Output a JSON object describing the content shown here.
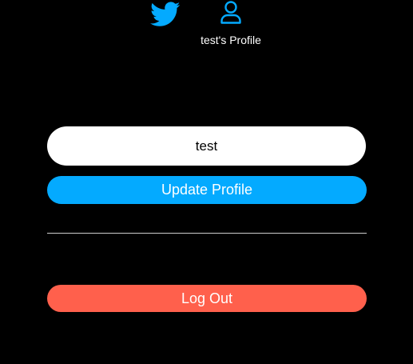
{
  "colors": {
    "background": "#000000",
    "accent_blue": "#04aaff",
    "logout_red": "#ff604c",
    "input_background": "#ffffff"
  },
  "nav": {
    "home_icon": "twitter-bird-icon",
    "profile_icon": "user-icon",
    "profile_label": "test's Profile"
  },
  "profile_form": {
    "display_name_value": "test",
    "update_button_label": "Update Profile"
  },
  "logout": {
    "label": "Log Out"
  }
}
